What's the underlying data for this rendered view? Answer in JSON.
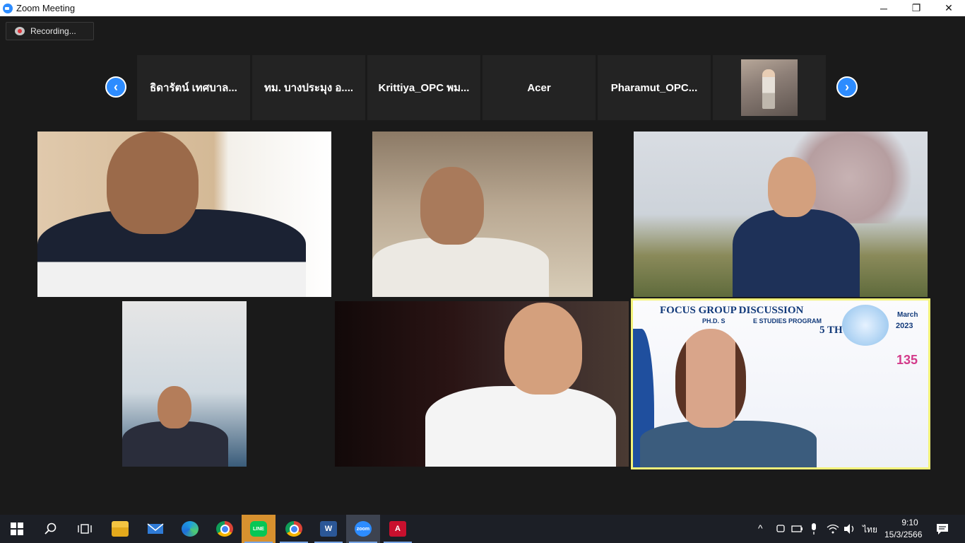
{
  "window": {
    "title": "Zoom Meeting",
    "minimize": "─",
    "restore": "❐",
    "close": "✕"
  },
  "recording": {
    "label": "Recording..."
  },
  "strip": {
    "prev_arrow": "‹",
    "next_arrow": "›",
    "participants": [
      "ธิดารัตน์ เทศบาล...",
      "ทม. บางประมุง อ....",
      "Krittiya_OPC พม...",
      "Acer",
      "Pharamut_OPC..."
    ]
  },
  "slide": {
    "title": "FOCUS GROUP DISCUSSION",
    "subtitle": "PH.D. S",
    "subtitle_end": "E STUDIES PROGRAM",
    "ordinal": "5 TH",
    "month": "March",
    "year": "2023",
    "badge": "135"
  },
  "taskbar": {
    "line_label": "LINE",
    "zoom_label": "zoom",
    "word_label": "W",
    "pdf_label": "A",
    "language": "ไทย",
    "time": "9:10",
    "date": "15/3/2566"
  },
  "colors": {
    "accent": "#2d8cff",
    "active_speaker_border": "#f2f27a",
    "recording_dot": "#e0353b"
  }
}
